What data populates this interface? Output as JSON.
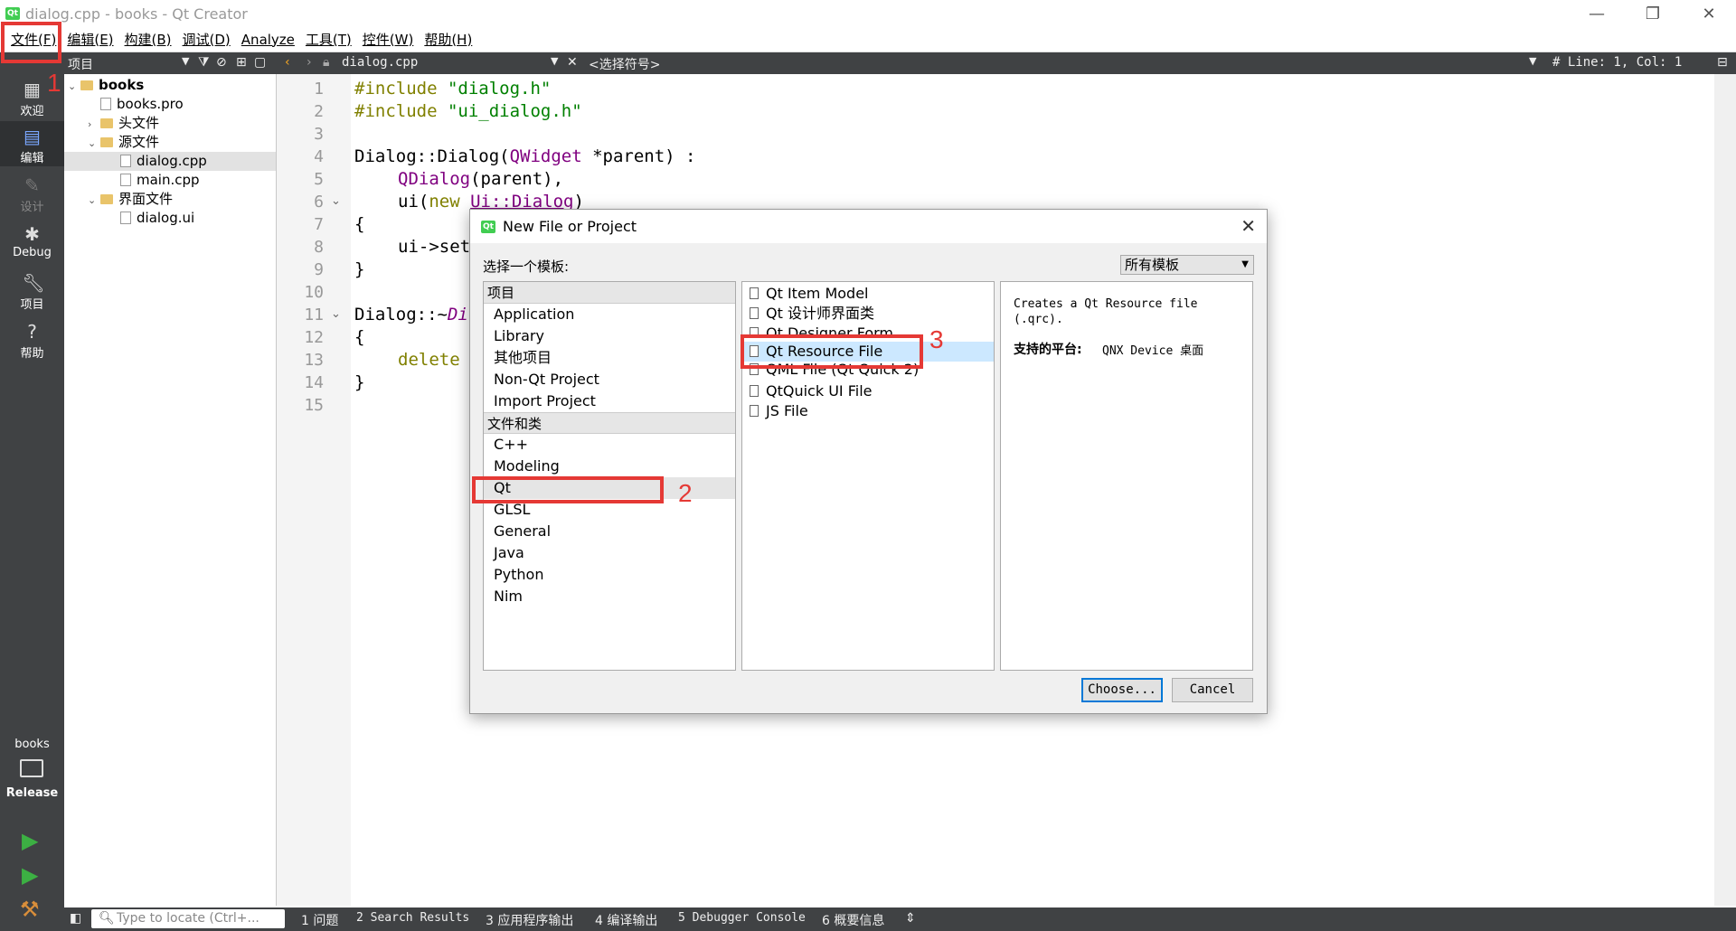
{
  "window": {
    "title": "dialog.cpp - books - Qt Creator",
    "app_icon": "qt-logo-icon",
    "controls": [
      "—",
      "❐",
      "✕"
    ]
  },
  "menu": [
    "文件(F)",
    "编辑(E)",
    "构建(B)",
    "调试(D)",
    "Analyze",
    "工具(T)",
    "控件(W)",
    "帮助(H)"
  ],
  "modes": [
    {
      "label": "欢迎",
      "icon": "grid-icon"
    },
    {
      "label": "编辑",
      "icon": "edit-document-icon"
    },
    {
      "label": "设计",
      "icon": "pencil-icon"
    },
    {
      "label": "Debug",
      "icon": "bug-icon"
    },
    {
      "label": "项目",
      "icon": "wrench-icon"
    },
    {
      "label": "帮助",
      "icon": "help-icon"
    }
  ],
  "kit": {
    "project": "books",
    "config": "Release"
  },
  "toolbar": {
    "project_panel": "项目",
    "file": "dialog.cpp",
    "symbol": "<选择符号>",
    "position": "# Line: 1, Col: 1"
  },
  "tree": [
    {
      "label": "books",
      "level": 0,
      "arrow": "⌄",
      "type": "project"
    },
    {
      "label": "books.pro",
      "level": 1,
      "arrow": "",
      "type": "file"
    },
    {
      "label": "头文件",
      "level": 1,
      "arrow": "›",
      "type": "folder"
    },
    {
      "label": "源文件",
      "level": 1,
      "arrow": "⌄",
      "type": "folder"
    },
    {
      "label": "dialog.cpp",
      "level": 2,
      "arrow": "",
      "type": "file",
      "selected": true
    },
    {
      "label": "main.cpp",
      "level": 2,
      "arrow": "",
      "type": "file"
    },
    {
      "label": "界面文件",
      "level": 1,
      "arrow": "⌄",
      "type": "folder"
    },
    {
      "label": "dialog.ui",
      "level": 2,
      "arrow": "",
      "type": "file"
    }
  ],
  "code": {
    "line_numbers": [
      "1",
      "2",
      "3",
      "4",
      "5",
      "6",
      "7",
      "8",
      "9",
      "10",
      "11",
      "12",
      "13",
      "14",
      "15"
    ],
    "l1": {
      "kw": "#include",
      "str": "\"dialog.h\""
    },
    "l2": {
      "kw": "#include",
      "str": "\"ui_dialog.h\""
    },
    "l4": {
      "a": "Dialog::Dialog(",
      "b": "QWidget",
      "c": " *parent) :"
    },
    "l5": {
      "a": "QDialog",
      "b": "(parent),"
    },
    "l6": {
      "a": "ui(",
      "b": "new",
      "c": " ",
      "d": "Ui::Dialog",
      "e": ")"
    },
    "l7": "{",
    "l8": "ui->set",
    "l9": "}",
    "l11": {
      "a": "Dialog::~",
      "b": "Di"
    },
    "l12": "{",
    "l13": "delete",
    "l14": "}"
  },
  "status": {
    "locate_placeholder": "Type to locate (Ctrl+...",
    "tabs": [
      "1 问题",
      "2 Search Results",
      "3 应用程序输出",
      "4 编译输出",
      "5 Debugger Console",
      "6 概要信息"
    ]
  },
  "dialog": {
    "title": "New File or Project",
    "choose_template": "选择一个模板:",
    "filter": "所有模板",
    "projects_header": "项目",
    "projects": [
      "Application",
      "Library",
      "其他项目",
      "Non-Qt Project",
      "Import Project"
    ],
    "files_header": "文件和类",
    "files": [
      "C++",
      "Modeling",
      "Qt",
      "GLSL",
      "General",
      "Java",
      "Python",
      "Nim"
    ],
    "templates": [
      "Qt Item Model",
      "Qt 设计师界面类",
      "Qt Designer Form",
      "Qt Resource File",
      "QML File (Qt Quick 2)",
      "QtQuick UI File",
      "JS File"
    ],
    "description": "Creates a Qt Resource file (.qrc).",
    "platforms_label": "支持的平台:",
    "platforms": "QNX Device 桌面",
    "choose": "Choose...",
    "cancel": "Cancel"
  },
  "annotations": [
    "1",
    "2",
    "3"
  ],
  "colors": {
    "sidebar": "#404244",
    "highlight": "#e53935",
    "selection": "#cce8ff"
  }
}
